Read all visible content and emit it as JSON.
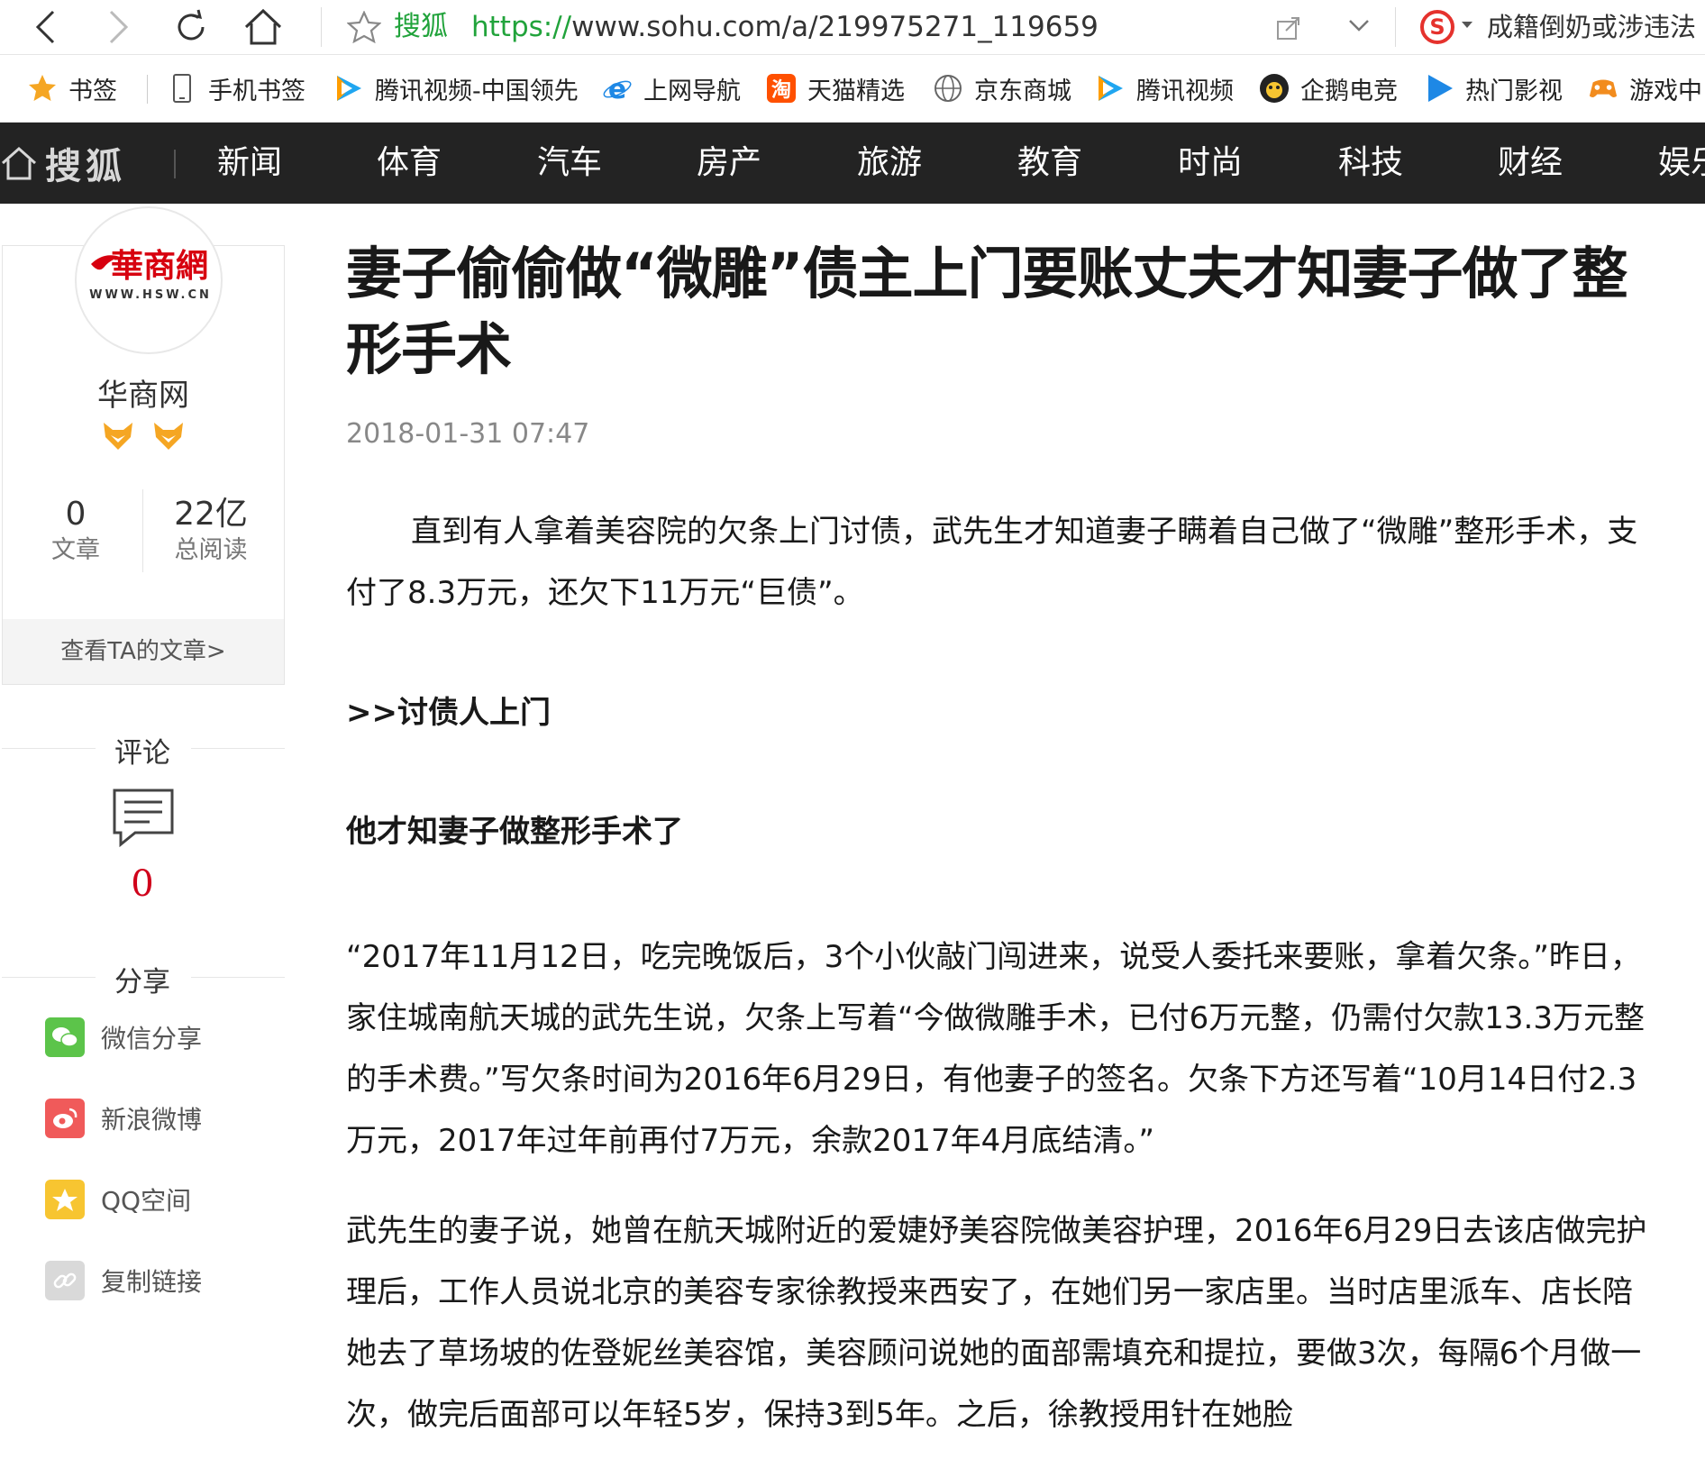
{
  "browser": {
    "site_name": "搜狐",
    "url_scheme": "https://",
    "url_rest": "www.sohu.com/a/219975271_119659",
    "hot_search": "成籍倒奶或涉违法"
  },
  "bookmarks": {
    "items": [
      {
        "label": "书签",
        "icon": "star-icon"
      },
      {
        "label": "手机书签",
        "icon": "phone-icon"
      },
      {
        "label": "腾讯视频-中国领先",
        "icon": "tencent-video-icon"
      },
      {
        "label": "上网导航",
        "icon": "ie-icon"
      },
      {
        "label": "天猫精选",
        "icon": "taobao-icon"
      },
      {
        "label": "京东商城",
        "icon": "globe-icon"
      },
      {
        "label": "腾讯视频",
        "icon": "tencent-video-icon"
      },
      {
        "label": "企鹅电竞",
        "icon": "penguin-icon"
      },
      {
        "label": "热门影视",
        "icon": "play-icon"
      },
      {
        "label": "游戏中",
        "icon": "gamepad-icon"
      }
    ]
  },
  "nav": {
    "logo": "搜狐",
    "channels": [
      "新闻",
      "体育",
      "汽车",
      "房产",
      "旅游",
      "教育",
      "时尚",
      "科技",
      "财经",
      "娱乐"
    ]
  },
  "author": {
    "logo_text": "華商網",
    "logo_url": "WWW.HSW.CN",
    "name": "华商网",
    "articles_count": "0",
    "articles_label": "文章",
    "reads_count": "22亿",
    "reads_label": "总阅读",
    "view_link": "查看TA的文章>"
  },
  "sidebar": {
    "comments_label": "评论",
    "comments_count": "0",
    "share_label": "分享",
    "share_items": [
      {
        "label": "微信分享",
        "color": "#5cc44a"
      },
      {
        "label": "新浪微博",
        "color": "#f05a5a"
      },
      {
        "label": "QQ空间",
        "color": "#f7c531"
      },
      {
        "label": "复制链接",
        "color": "#d9d9d9"
      }
    ]
  },
  "article": {
    "title": "妻子偷偷做“微雕”债主上门要账丈夫才知妻子做了整形手术",
    "time": "2018-01-31 07:47",
    "lead": "直到有人拿着美容院的欠条上门讨债，武先生才知道妻子瞒着自己做了“微雕”整形手术，支付了8.3万元，还欠下11万元“巨债”。",
    "subhead1": ">>讨债人上门",
    "subhead2": "他才知妻子做整形手术了",
    "para1": "“2017年11月12日，吃完晚饭后，3个小伙敲门闯进来，说受人委托来要账，拿着欠条。”昨日，家住城南航天城的武先生说，欠条上写着“今做微雕手术，已付6万元整，仍需付欠款13.3万元整的手术费。”写欠条时间为2016年6月29日，有他妻子的签名。欠条下方还写着“10月14日付2.3万元，2017年过年前再付7万元，余款2017年4月底结清。”",
    "para2": "武先生的妻子说，她曾在航天城附近的爱婕妤美容院做美容护理，2016年6月29日去该店做完护理后，工作人员说北京的美容专家徐教授来西安了，在她们另一家店里。当时店里派车、店长陪她去了草场坡的佐登妮丝美容馆，美容顾问说她的面部需填充和提拉，要做3次，每隔6个月做一次，做完后面部可以年轻5岁，保持3到5年。之后，徐教授用针在她脸"
  }
}
